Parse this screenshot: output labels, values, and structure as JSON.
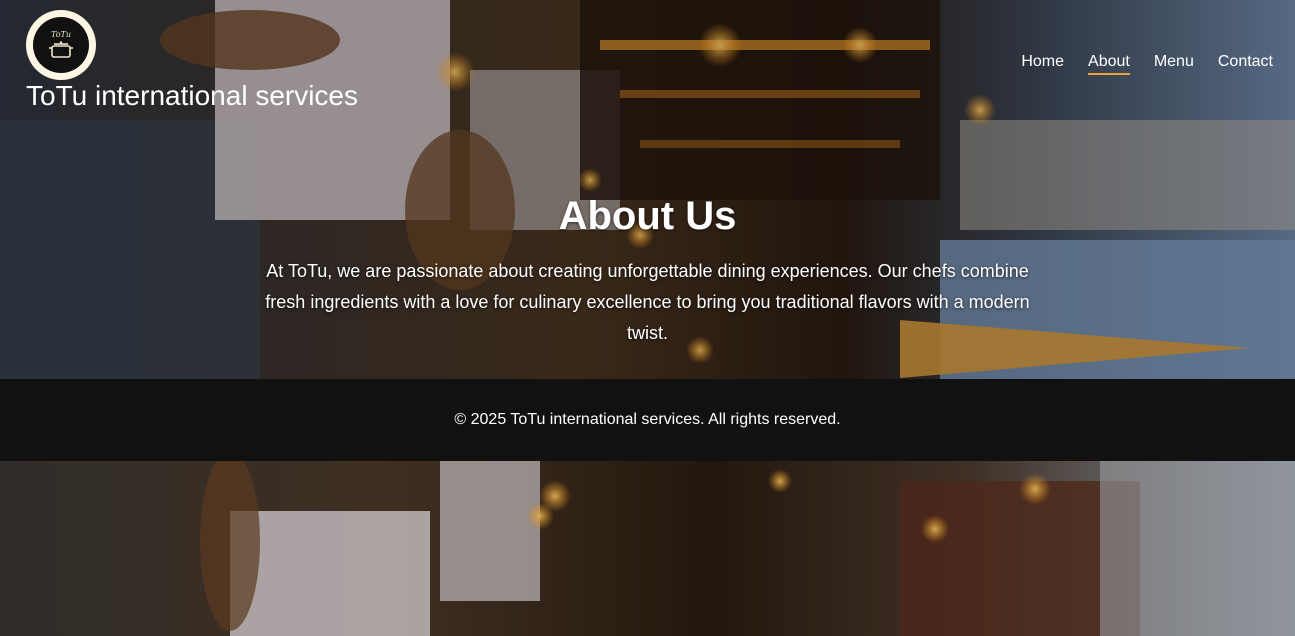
{
  "header": {
    "logo_text": "ToTu",
    "site_title": "ToTu international services"
  },
  "nav": {
    "items": [
      {
        "label": "Home"
      },
      {
        "label": "About",
        "active": true
      },
      {
        "label": "Menu"
      },
      {
        "label": "Contact"
      }
    ]
  },
  "hero": {
    "title": "About Us",
    "body": "At ToTu, we are passionate about creating unforgettable dining experiences. Our chefs combine fresh ingredients with a love for culinary excellence to bring you traditional flavors with a modern twist."
  },
  "footer": {
    "copyright": "© 2025 ToTu international services. All rights reserved."
  },
  "colors": {
    "accent": "#e8a33a",
    "footer_bg": "#111111",
    "text": "#ffffff"
  },
  "icons": {
    "logo": "cooking-pot-icon"
  }
}
